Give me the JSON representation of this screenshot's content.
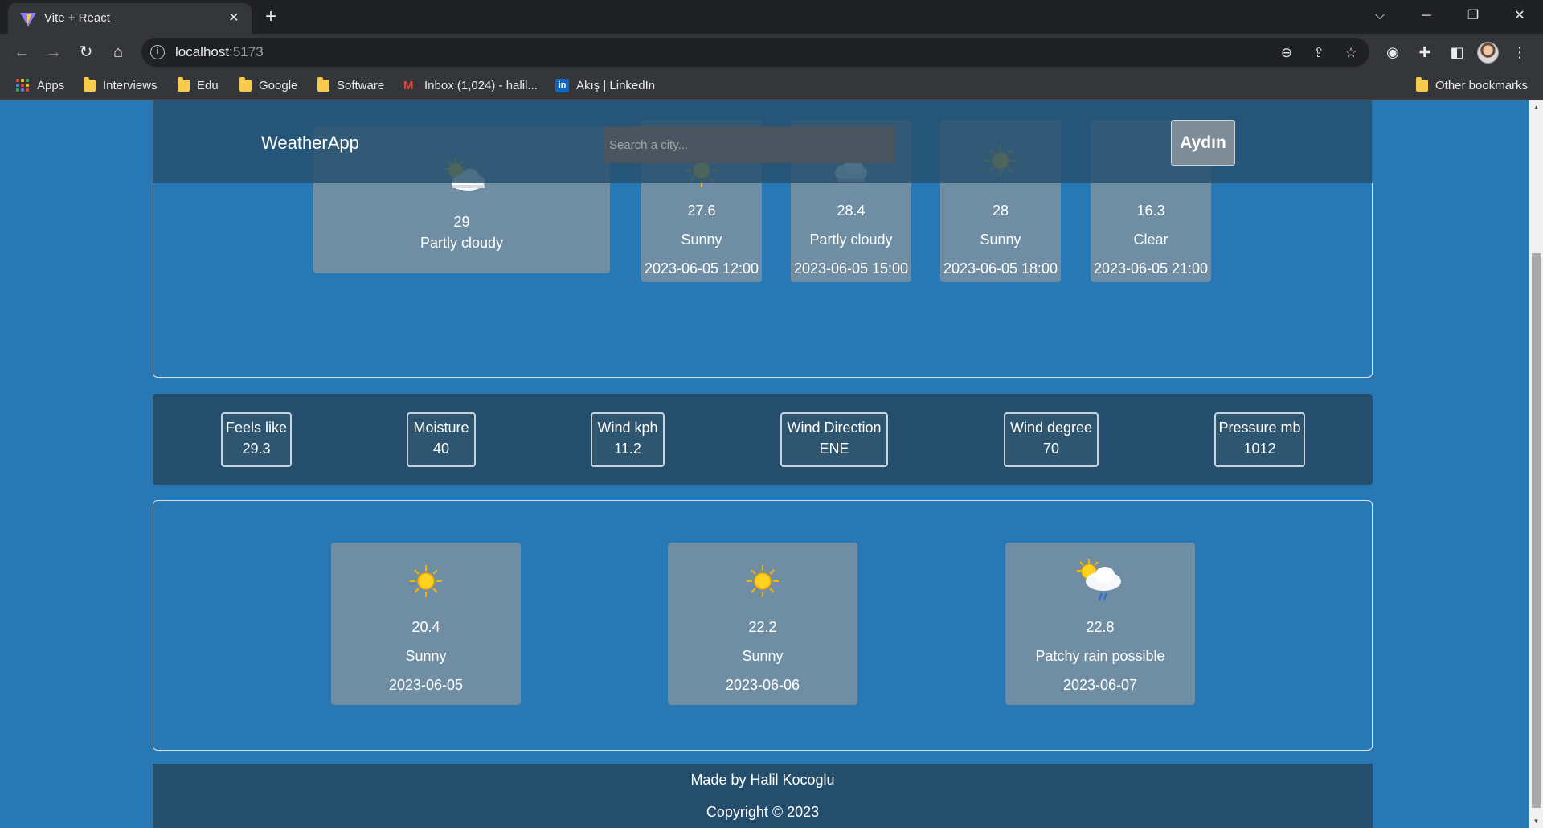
{
  "browser": {
    "tab_title": "Vite + React",
    "url_host": "localhost",
    "url_port": ":5173",
    "bookmarks": [
      {
        "label": "Apps"
      },
      {
        "label": "Interviews"
      },
      {
        "label": "Edu"
      },
      {
        "label": "Google"
      },
      {
        "label": "Software"
      },
      {
        "label": "Inbox (1,024) - halil..."
      },
      {
        "label": "Akış | LinkedIn"
      }
    ],
    "other_bookmarks": "Other bookmarks"
  },
  "app": {
    "brand": "WeatherApp",
    "search_placeholder": "Search a city...",
    "city_button": "Aydın",
    "current": {
      "temp": "29",
      "condition": "Partly cloudy",
      "icon": "partly-cloudy-icon"
    },
    "hourly": [
      {
        "temp": "27.6",
        "condition": "Sunny",
        "time": "2023-06-05 12:00",
        "icon": "sun-icon"
      },
      {
        "temp": "28.4",
        "condition": "Partly cloudy",
        "time": "2023-06-05 15:00",
        "icon": "cloud-icon"
      },
      {
        "temp": "28",
        "condition": "Sunny",
        "time": "2023-06-05 18:00",
        "icon": "sun-icon"
      },
      {
        "temp": "16.3",
        "condition": "Clear",
        "time": "2023-06-05 21:00",
        "icon": "moon-icon"
      }
    ],
    "details": [
      {
        "label": "Feels like",
        "value": "29.3"
      },
      {
        "label": "Moisture",
        "value": "40"
      },
      {
        "label": "Wind kph",
        "value": "11.2"
      },
      {
        "label": "Wind Direction",
        "value": "ENE"
      },
      {
        "label": "Wind degree",
        "value": "70"
      },
      {
        "label": "Pressure mb",
        "value": "1012"
      }
    ],
    "daily": [
      {
        "temp": "20.4",
        "condition": "Sunny",
        "date": "2023-06-05",
        "icon": "sun-icon"
      },
      {
        "temp": "22.2",
        "condition": "Sunny",
        "date": "2023-06-06",
        "icon": "sun-icon"
      },
      {
        "temp": "22.8",
        "condition": "Patchy rain possible",
        "date": "2023-06-07",
        "icon": "patchy-rain-icon"
      }
    ],
    "footer": {
      "made_by": "Made by Halil Kocoglu",
      "copyright": "Copyright © 2023"
    }
  }
}
